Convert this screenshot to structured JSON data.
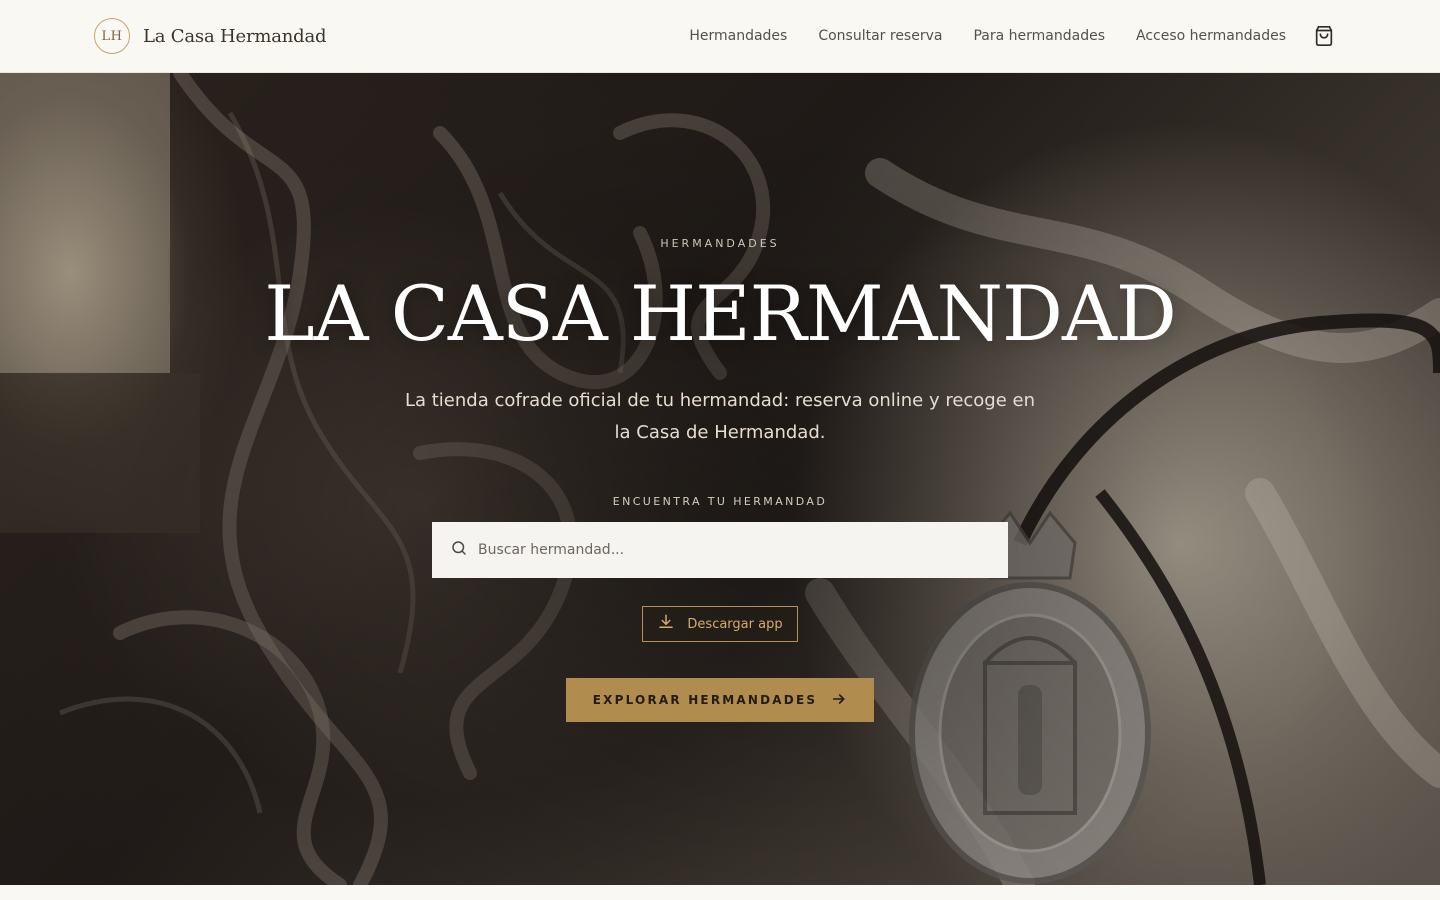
{
  "header": {
    "logo_initials": "LH",
    "brand_name": "La Casa Hermandad",
    "nav": [
      {
        "label": "Hermandades"
      },
      {
        "label": "Consultar reserva"
      },
      {
        "label": "Para hermandades"
      },
      {
        "label": "Acceso hermandades"
      }
    ],
    "cart_icon": "shopping-bag-icon"
  },
  "hero": {
    "eyebrow": "HERMANDADES",
    "title": "LA CASA HERMANDAD",
    "subtitle": "La tienda cofrade oficial de tu hermandad: reserva online y recoge en la Casa de Hermandad.",
    "search_label": "ENCUENTRA TU HERMANDAD",
    "search_placeholder": "Buscar hermandad...",
    "search_value": "",
    "download_app_label": "Descargar app",
    "cta_label": "EXPLORAR HERMANDADES"
  },
  "colors": {
    "accent_gold": "#b08d4f",
    "header_bg": "#faf8f3",
    "text_dark": "#3b342c"
  }
}
